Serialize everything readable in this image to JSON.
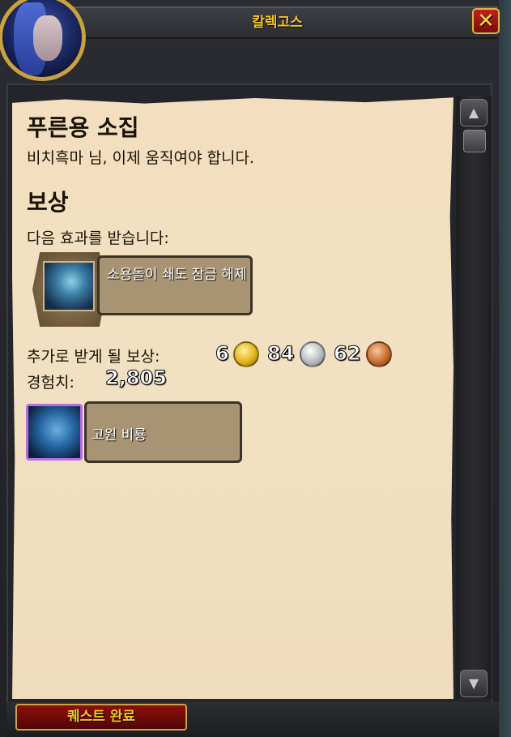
{
  "window": {
    "title": "칼렉고스",
    "close_label": "✕"
  },
  "quest": {
    "title": "푸른용 소집",
    "description": "비치흑마 님, 이제 움직여야 합니다."
  },
  "rewards": {
    "heading": "보상",
    "receive_text": "다음 효과를 받습니다:",
    "spell": {
      "name": "소용돌이 쇄도 잠금 해제",
      "icon": "vortex-spell-icon"
    },
    "money_label": "추가로 받게 될 보상:",
    "money": {
      "gold": "6",
      "silver": "84",
      "copper": "62"
    },
    "xp_label": "경험치:",
    "xp_value": "2,805",
    "item": {
      "name": "고원 비룡",
      "icon": "drake-mount-icon",
      "quality_color": "#b56ee0"
    }
  },
  "footer": {
    "complete_button": "퀘스트 완료"
  },
  "colors": {
    "title_gold": "#f4c42a",
    "parchment": "#f2e0c3",
    "button_red": "#8d0f0c"
  }
}
